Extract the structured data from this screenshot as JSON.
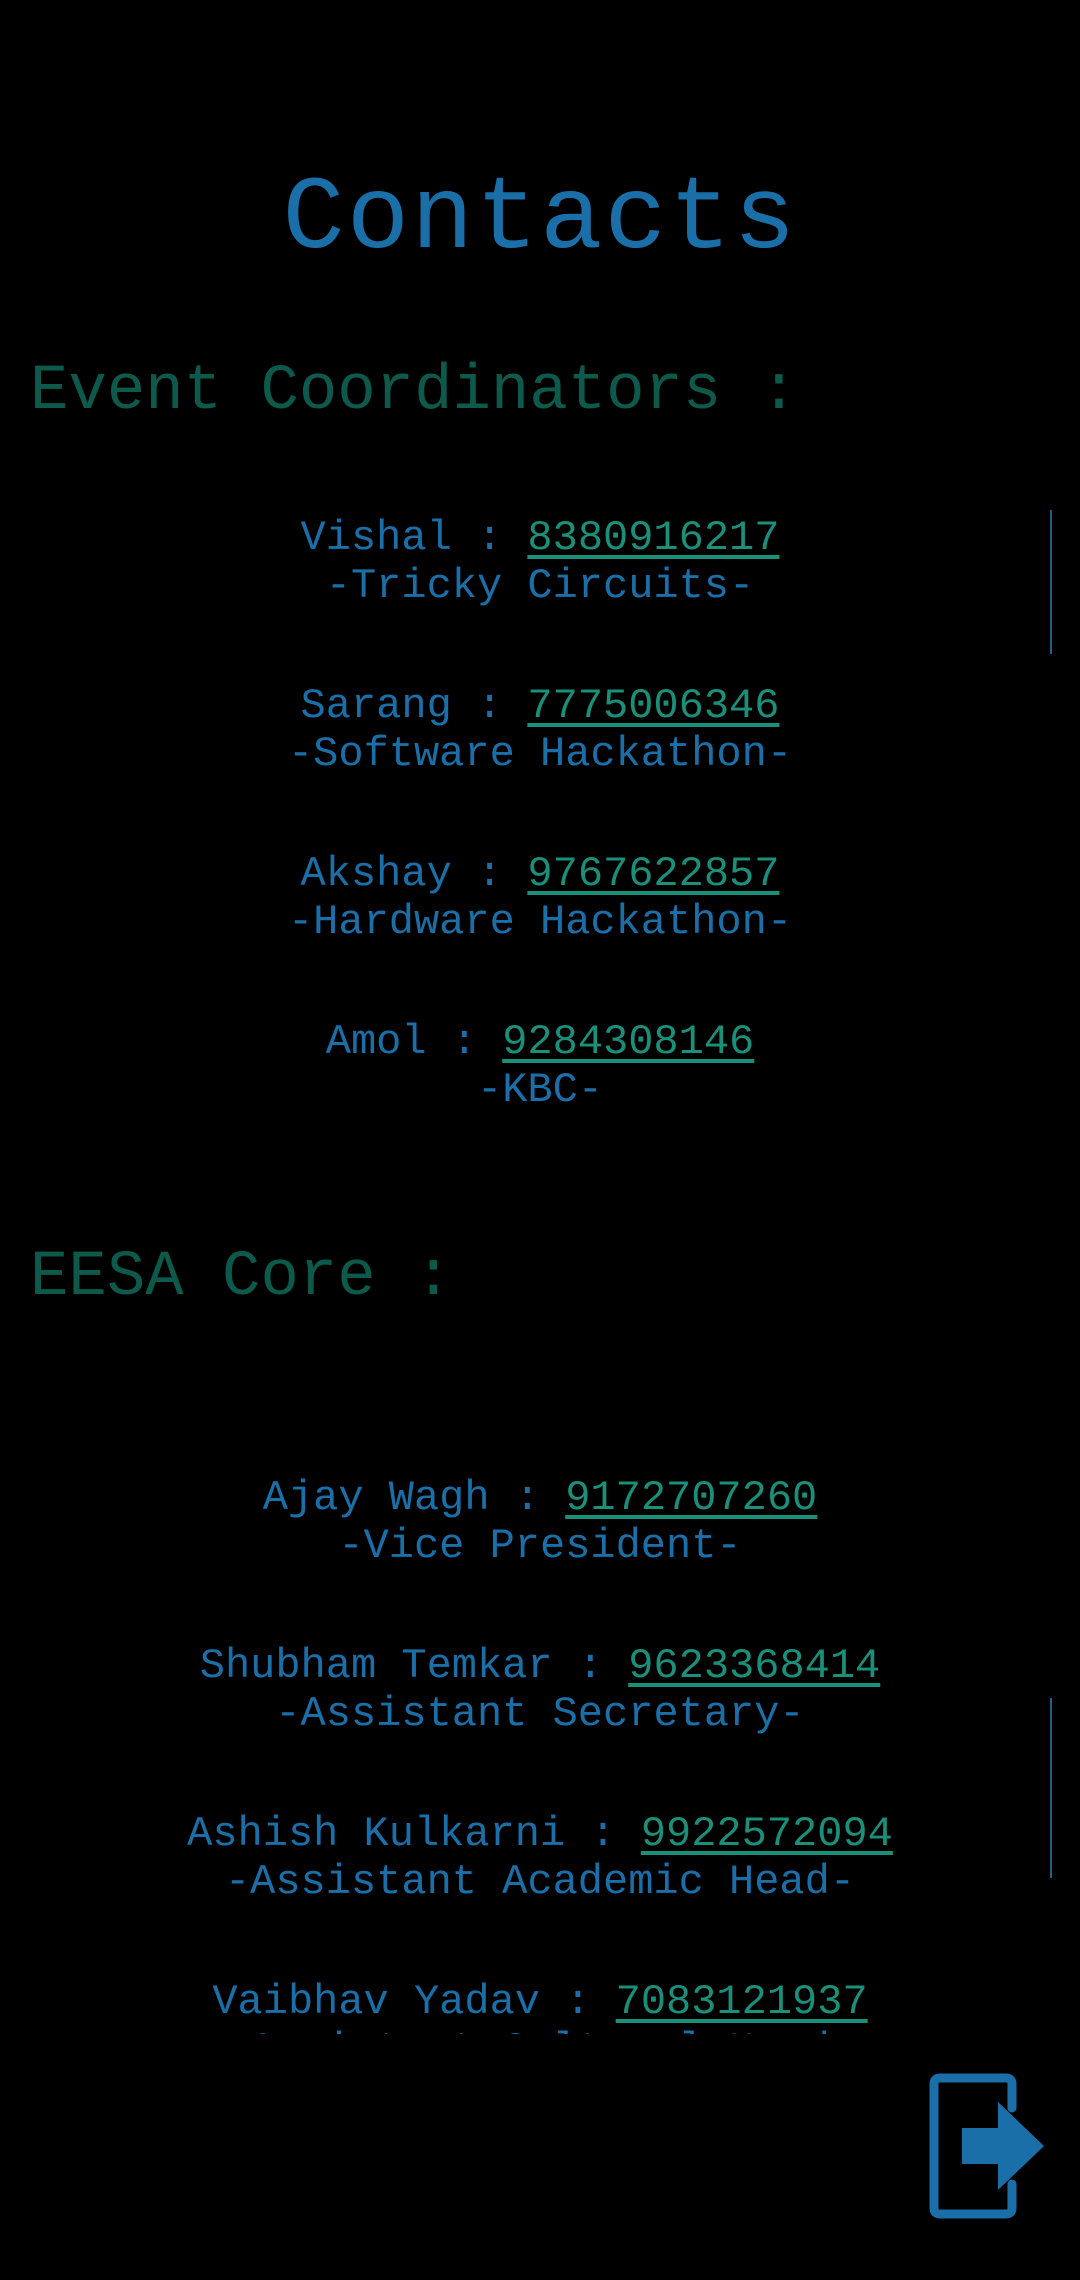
{
  "page": {
    "title": "Contacts"
  },
  "event_coordinators": {
    "heading": "Event Coordinators :",
    "contacts": [
      {
        "name": "Vishal",
        "separator": " : ",
        "phone": "8380916217",
        "role": "-Tricky Circuits-"
      },
      {
        "name": "Sarang",
        "separator": " : ",
        "phone": "7775006346",
        "role": "-Software Hackathon-"
      },
      {
        "name": "Akshay",
        "separator": " : ",
        "phone": "9767622857",
        "role": "-Hardware Hackathon-"
      },
      {
        "name": "Amol",
        "separator": " : ",
        "phone": "9284308146",
        "role": "-KBC-"
      }
    ]
  },
  "eesa_core": {
    "heading": "EESA Core :",
    "contacts": [
      {
        "name": "Ajay Wagh",
        "separator": " : ",
        "phone": "9172707260",
        "role": "-Vice President-"
      },
      {
        "name": "Shubham Temkar",
        "separator": " : ",
        "phone": "9623368414",
        "role": "-Assistant Secretary-"
      },
      {
        "name": "Ashish Kulkarni",
        "separator": " : ",
        "phone": "9922572094",
        "role": "-Assistant Academic Head-"
      },
      {
        "name": "Vaibhav Yadav",
        "separator": " : ",
        "phone": "7083121937",
        "role": "-Assistant Cultural Head-"
      }
    ]
  },
  "logout": {
    "icon": "logout-icon"
  },
  "colors": {
    "background": "#000000",
    "title": "#1a6fa8",
    "section_heading": "#0d5a4c",
    "text": "#1a6fa8",
    "phone_link": "#1a8f7a"
  }
}
